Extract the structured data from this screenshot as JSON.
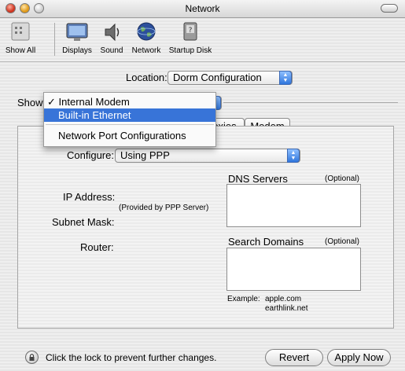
{
  "window": {
    "title": "Network"
  },
  "toolbar": {
    "items": [
      {
        "label": "Show All",
        "icon": "show-all-icon"
      },
      {
        "label": "Displays",
        "icon": "displays-icon"
      },
      {
        "label": "Sound",
        "icon": "sound-icon"
      },
      {
        "label": "Network",
        "icon": "network-icon"
      },
      {
        "label": "Startup Disk",
        "icon": "startup-disk-icon"
      }
    ]
  },
  "location": {
    "label": "Location:",
    "value": "Dorm Configuration"
  },
  "show": {
    "label": "Show",
    "menu": {
      "checkmark": "✓",
      "items": [
        "Internal Modem",
        "Built-in Ethernet",
        "Network Port Configurations"
      ],
      "selected_index": 0,
      "highlighted_index": 1
    }
  },
  "tabs": [
    {
      "label": "oxies"
    },
    {
      "label": "Modem"
    }
  ],
  "form": {
    "configure_label": "Configure:",
    "configure_value": "Using PPP",
    "ip_label": "IP Address:",
    "ip_note": "(Provided by PPP Server)",
    "subnet_label": "Subnet Mask:",
    "router_label": "Router:",
    "dns_label": "DNS Servers",
    "dns_optional": "(Optional)",
    "search_label": "Search Domains",
    "search_optional": "(Optional)",
    "example_label": "Example:",
    "example_1": "apple.com",
    "example_2": "earthlink.net"
  },
  "footer": {
    "lock_text": "Click the lock to prevent further changes.",
    "revert": "Revert",
    "apply": "Apply Now"
  },
  "colors": {
    "highlight": "#3874d8",
    "popup_arrow": "#2f76dd"
  }
}
